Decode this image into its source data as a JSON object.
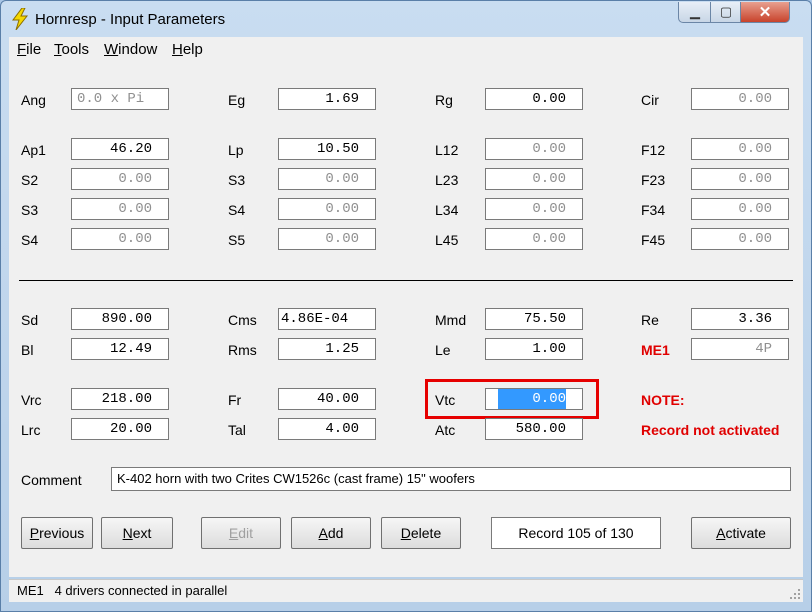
{
  "window": {
    "title": "Hornresp - Input Parameters"
  },
  "menu": [
    {
      "key": "F",
      "rest": "ile"
    },
    {
      "key": "T",
      "rest": "ools"
    },
    {
      "key": "W",
      "rest": "indow"
    },
    {
      "key": "H",
      "rest": "elp"
    }
  ],
  "params": {
    "ang": {
      "label": "Ang",
      "value": "0.0 x Pi"
    },
    "eg": {
      "label": "Eg",
      "value": "1.69"
    },
    "rg": {
      "label": "Rg",
      "value": "0.00"
    },
    "cir": {
      "label": "Cir",
      "value": "0.00"
    },
    "ap1": {
      "label": "Ap1",
      "value": "46.20"
    },
    "lp": {
      "label": "Lp",
      "value": "10.50"
    },
    "l12": {
      "label": "L12",
      "value": "0.00"
    },
    "f12": {
      "label": "F12",
      "value": "0.00"
    },
    "s2": {
      "label": "S2",
      "value": "0.00"
    },
    "s3b": {
      "label": "S3",
      "value": "0.00"
    },
    "l23": {
      "label": "L23",
      "value": "0.00"
    },
    "f23": {
      "label": "F23",
      "value": "0.00"
    },
    "s3": {
      "label": "S3",
      "value": "0.00"
    },
    "s4b": {
      "label": "S4",
      "value": "0.00"
    },
    "l34": {
      "label": "L34",
      "value": "0.00"
    },
    "f34": {
      "label": "F34",
      "value": "0.00"
    },
    "s4": {
      "label": "S4",
      "value": "0.00"
    },
    "s5": {
      "label": "S5",
      "value": "0.00"
    },
    "l45": {
      "label": "L45",
      "value": "0.00"
    },
    "f45": {
      "label": "F45",
      "value": "0.00"
    },
    "sd": {
      "label": "Sd",
      "value": "890.00"
    },
    "cms": {
      "label": "Cms",
      "value": "4.86E-04"
    },
    "mmd": {
      "label": "Mmd",
      "value": "75.50"
    },
    "re": {
      "label": "Re",
      "value": "3.36"
    },
    "bl": {
      "label": "Bl",
      "value": "12.49"
    },
    "rms": {
      "label": "Rms",
      "value": "1.25"
    },
    "le": {
      "label": "Le",
      "value": "1.00"
    },
    "me1": {
      "label": "ME1",
      "value": "4P"
    },
    "vrc": {
      "label": "Vrc",
      "value": "218.00"
    },
    "fr": {
      "label": "Fr",
      "value": "40.00"
    },
    "vtc": {
      "label": "Vtc",
      "value": "0.00"
    },
    "lrc": {
      "label": "Lrc",
      "value": "20.00"
    },
    "tal": {
      "label": "Tal",
      "value": "4.00"
    },
    "atc": {
      "label": "Atc",
      "value": "580.00"
    }
  },
  "note": {
    "title": "NOTE:",
    "text": "Record not activated"
  },
  "comment": {
    "label": "Comment",
    "value": "K-402 horn with two Crites CW1526c (cast frame) 15\" woofers"
  },
  "buttons": {
    "previous": {
      "key": "P",
      "rest": "revious"
    },
    "next": {
      "key": "N",
      "rest": "ext"
    },
    "edit": {
      "key": "E",
      "rest": "dit"
    },
    "add": {
      "key": "A",
      "rest": "dd"
    },
    "delete": {
      "key": "D",
      "rest": "elete"
    },
    "activate": {
      "key": "A",
      "rest": "ctivate"
    }
  },
  "record": "Record 105 of 130",
  "status": "ME1   4 drivers connected in parallel",
  "colors": {
    "note_red": "#e00000",
    "highlight_red": "#e60000",
    "selection": "#3399ff"
  }
}
